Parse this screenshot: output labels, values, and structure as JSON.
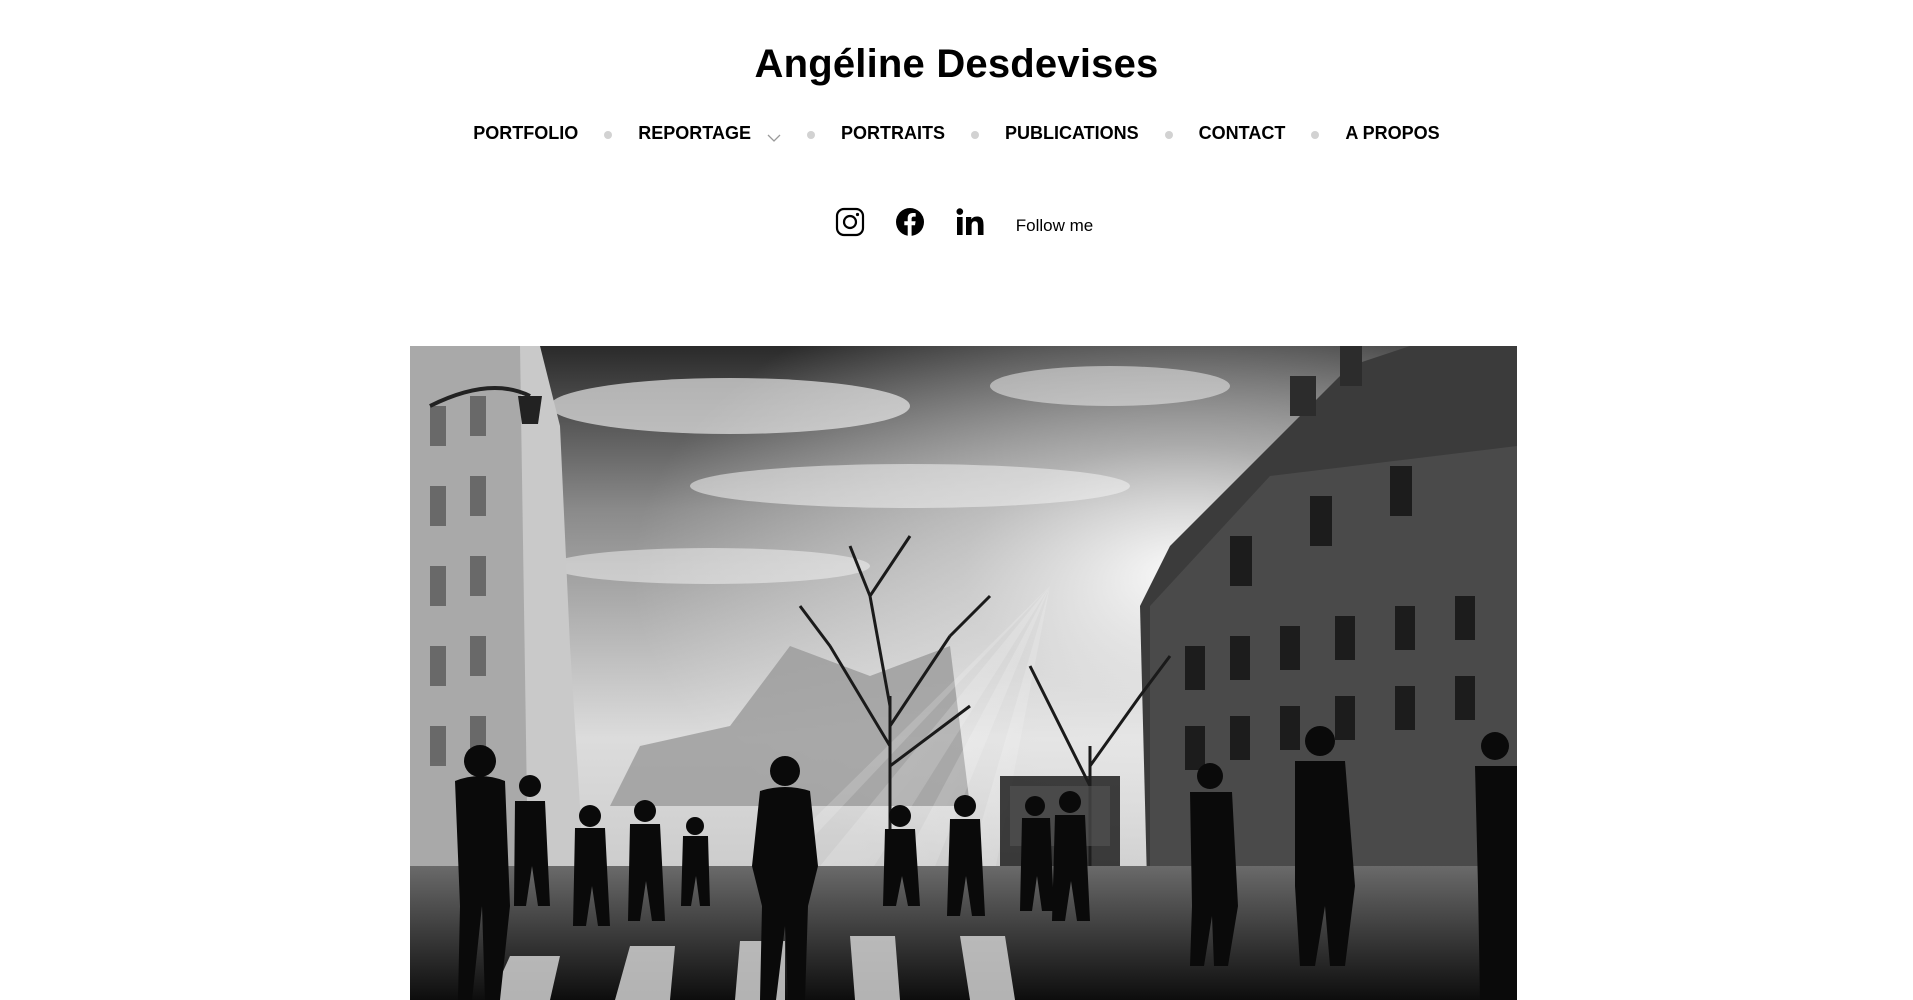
{
  "site": {
    "title": "Angéline Desdevises"
  },
  "nav": {
    "items": [
      {
        "label": "PORTFOLIO"
      },
      {
        "label": "REPORTAGE",
        "has_dropdown": true
      },
      {
        "label": "PORTRAITS"
      },
      {
        "label": "PUBLICATIONS"
      },
      {
        "label": "CONTACT"
      },
      {
        "label": "A PROPOS"
      }
    ]
  },
  "social": {
    "icons": [
      "instagram-icon",
      "facebook-icon",
      "linkedin-icon"
    ],
    "follow_label": "Follow me"
  },
  "hero": {
    "description_icon": "black-and-white-street-photo"
  },
  "colors": {
    "separator": "#d2d2d2",
    "text": "#000000",
    "background": "#ffffff"
  }
}
